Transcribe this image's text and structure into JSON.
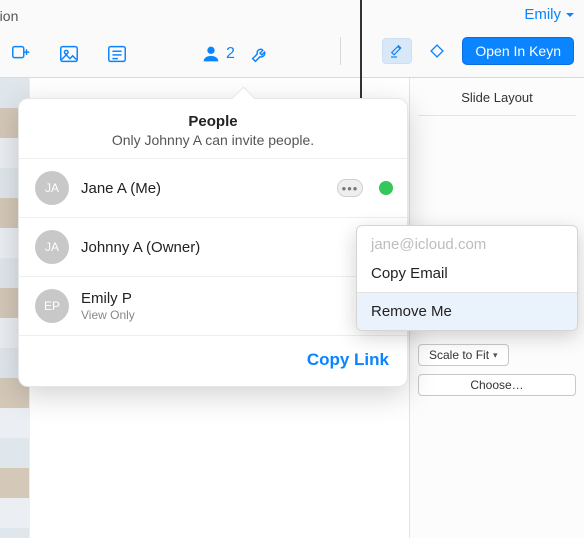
{
  "toolbar": {
    "doc_title_fragment": "ation",
    "collaborator_count": "2",
    "user_dropdown": "Emily",
    "open_button": "Open In Keyn"
  },
  "right_panel": {
    "tab": "Slide Layout",
    "scale_to_fit": "Scale to Fit",
    "choose": "Choose…"
  },
  "popover": {
    "title": "People",
    "subtitle": "Only Johnny A can invite people.",
    "people": [
      {
        "initials": "JA",
        "name": "Jane A (Me)",
        "role": "",
        "status": "green",
        "has_more": true
      },
      {
        "initials": "JA",
        "name": "Johnny A (Owner)",
        "role": "",
        "status": "",
        "has_more": false
      },
      {
        "initials": "EP",
        "name": "Emily P",
        "role": "View Only",
        "status": "orange",
        "has_more": false
      }
    ],
    "copy_link": "Copy Link"
  },
  "context_menu": {
    "email": "jane@icloud.com",
    "copy_email": "Copy Email",
    "remove_me": "Remove Me"
  }
}
